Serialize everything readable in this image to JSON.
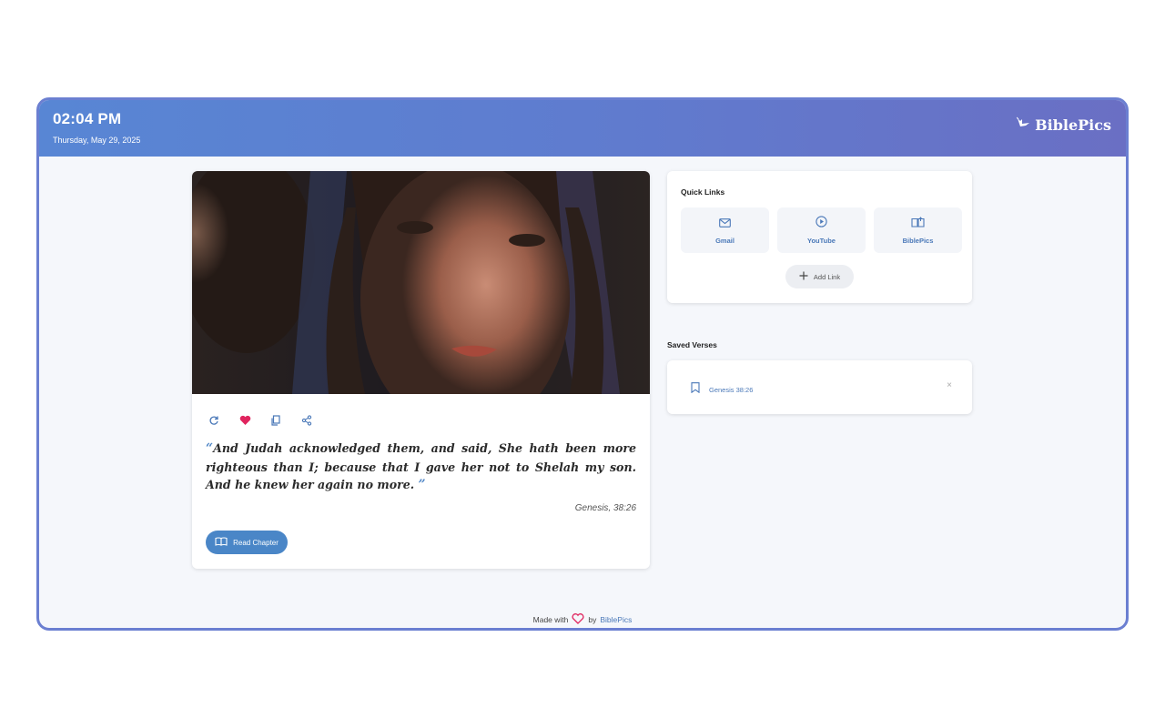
{
  "header": {
    "time": "02:04 PM",
    "date": "Thursday, May 29, 2025",
    "brand": "BiblePics"
  },
  "verse": {
    "open_quote": "“",
    "close_quote": "”",
    "text": "And Judah acknowledged them, and said, She hath been more righteous than I; because that I gave her not to Shelah my son. And he knew her again no more.",
    "reference": "Genesis, 38:26",
    "read_button": "Read Chapter",
    "actions": [
      "refresh-icon",
      "heart-icon",
      "copy-icon",
      "share-icon"
    ]
  },
  "quick_links": {
    "title": "Quick Links",
    "items": [
      {
        "label": "Gmail",
        "icon": "mail-icon"
      },
      {
        "label": "YouTube",
        "icon": "play-icon"
      },
      {
        "label": "BiblePics",
        "icon": "book-icon"
      }
    ],
    "add_label": "Add Link"
  },
  "saved_verses": {
    "title": "Saved Verses",
    "items": [
      {
        "label": "Genesis 38:26",
        "remove": "×"
      }
    ]
  },
  "footer": {
    "prefix": "Made with",
    "middle": "by",
    "brand": "BiblePics"
  },
  "colors": {
    "accent": "#4a86c7",
    "heart": "#e0245e",
    "header_start": "#5886d4",
    "header_end": "#6a6fc4"
  }
}
